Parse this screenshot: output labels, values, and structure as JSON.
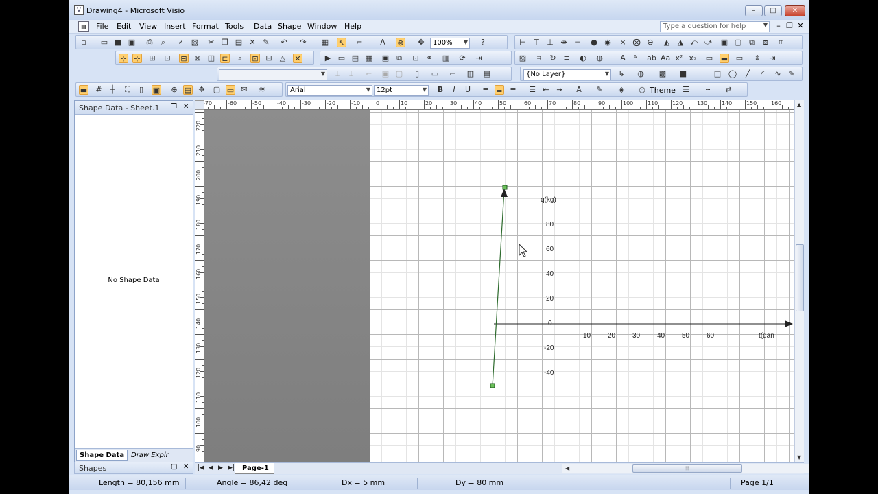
{
  "window": {
    "title": "Drawing4 - Microsoft Visio",
    "minimize": "–",
    "maximize": "□",
    "close": "✕"
  },
  "menu": {
    "items": [
      "File",
      "Edit",
      "View",
      "Insert",
      "Format",
      "Tools",
      "Data",
      "Shape",
      "Window",
      "Help"
    ],
    "help_placeholder": "Type a question for help",
    "mdi_min": "–",
    "mdi_restore": "❐",
    "mdi_close": "✕"
  },
  "toolbar": {
    "zoom": "100%",
    "layer": "{No Layer}",
    "font": "Arial",
    "font_size": "12pt",
    "bold": "B",
    "italic": "I",
    "underline": "U",
    "theme_label": "Theme"
  },
  "pane": {
    "title": "Shape Data - Sheet.1",
    "empty_message": "No Shape Data",
    "tabs": [
      "Shape Data",
      "Draw Explr"
    ],
    "shapes_label": "Shapes"
  },
  "rulers": {
    "horizontal_labels": [
      "-70",
      "-60",
      "-50",
      "-40",
      "-30",
      "-20",
      "-10",
      "0",
      "10",
      "20",
      "30",
      "40",
      "50",
      "60",
      "70",
      "80",
      "90",
      "100",
      "110",
      "120",
      "130",
      "140",
      "150",
      "160"
    ],
    "vertical_labels": [
      "220",
      "210",
      "200",
      "190",
      "180",
      "170",
      "160",
      "150",
      "140",
      "130",
      "120",
      "110",
      "100",
      "90"
    ]
  },
  "drawing": {
    "y_axis_label": "q(kg)",
    "x_axis_label": "t(dan",
    "y_tick_labels": [
      "80",
      "60",
      "40",
      "20",
      "0",
      "-20",
      "-40"
    ],
    "x_tick_labels": [
      "10",
      "20",
      "30",
      "40",
      "50",
      "60"
    ],
    "line_color": "#2e6b2e"
  },
  "page_tabs": {
    "current": "Page-1",
    "nav": [
      "|◀",
      "◀",
      "▶",
      "▶|"
    ]
  },
  "status": {
    "length": "Length = 80,156 mm",
    "angle": "Angle = 86,42 deg",
    "dx": "Dx = 5 mm",
    "dy": "Dy = 80 mm",
    "page": "Page 1/1"
  },
  "colors": {
    "chrome": "#d7e3f5",
    "highlight": "#ffcf6e",
    "offpage": "#858585"
  }
}
